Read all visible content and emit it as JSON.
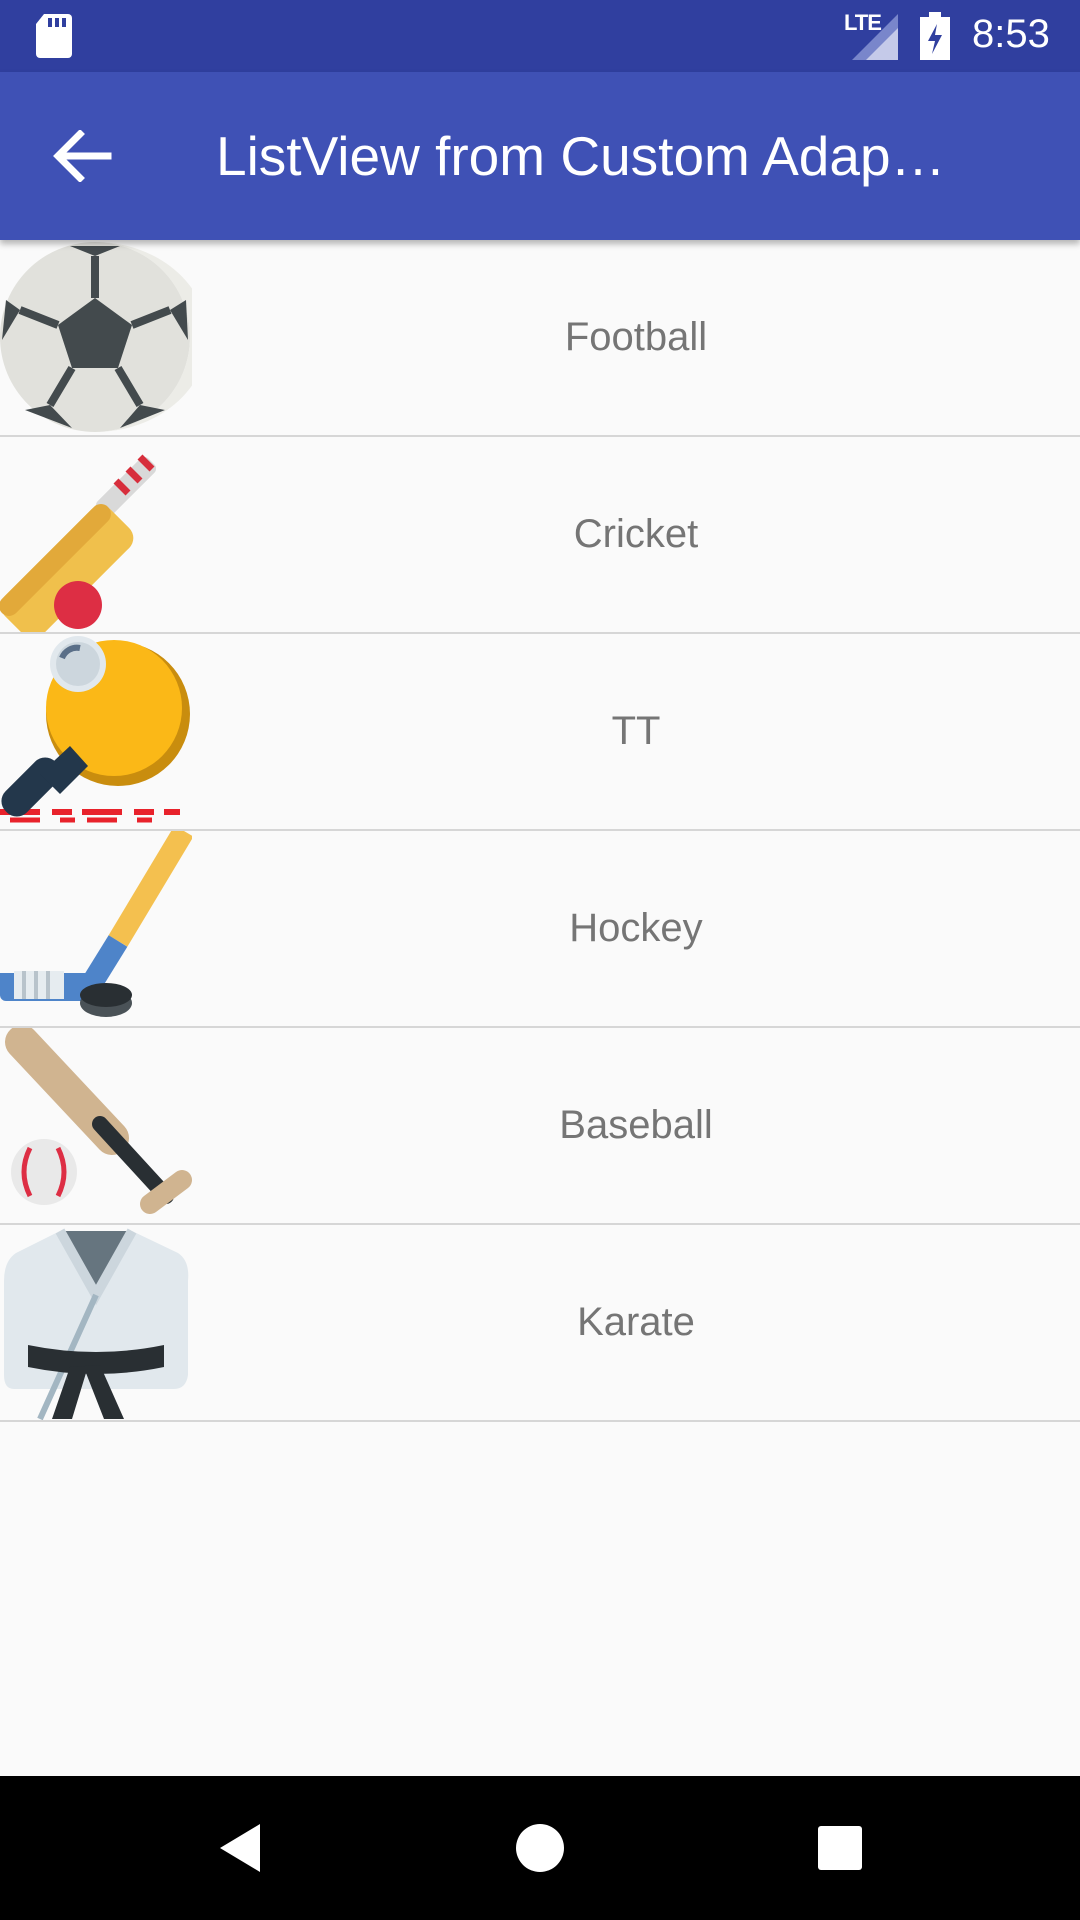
{
  "status_bar": {
    "network": "LTE",
    "time": "8:53"
  },
  "app_bar": {
    "title": "ListView from Custom Adap…",
    "back_icon": "arrow-back-icon"
  },
  "list": {
    "items": [
      {
        "label": "Football",
        "icon": "soccer-ball-icon"
      },
      {
        "label": "Cricket",
        "icon": "cricket-bat-icon"
      },
      {
        "label": "TT",
        "icon": "ping-pong-paddle-icon"
      },
      {
        "label": "Hockey",
        "icon": "hockey-stick-icon"
      },
      {
        "label": "Baseball",
        "icon": "baseball-bat-icon"
      },
      {
        "label": "Karate",
        "icon": "karate-gi-icon"
      }
    ]
  },
  "colors": {
    "status_bar": "#303f9f",
    "app_bar": "#3f51b5",
    "list_bg": "#fafafa",
    "label": "#757575"
  }
}
